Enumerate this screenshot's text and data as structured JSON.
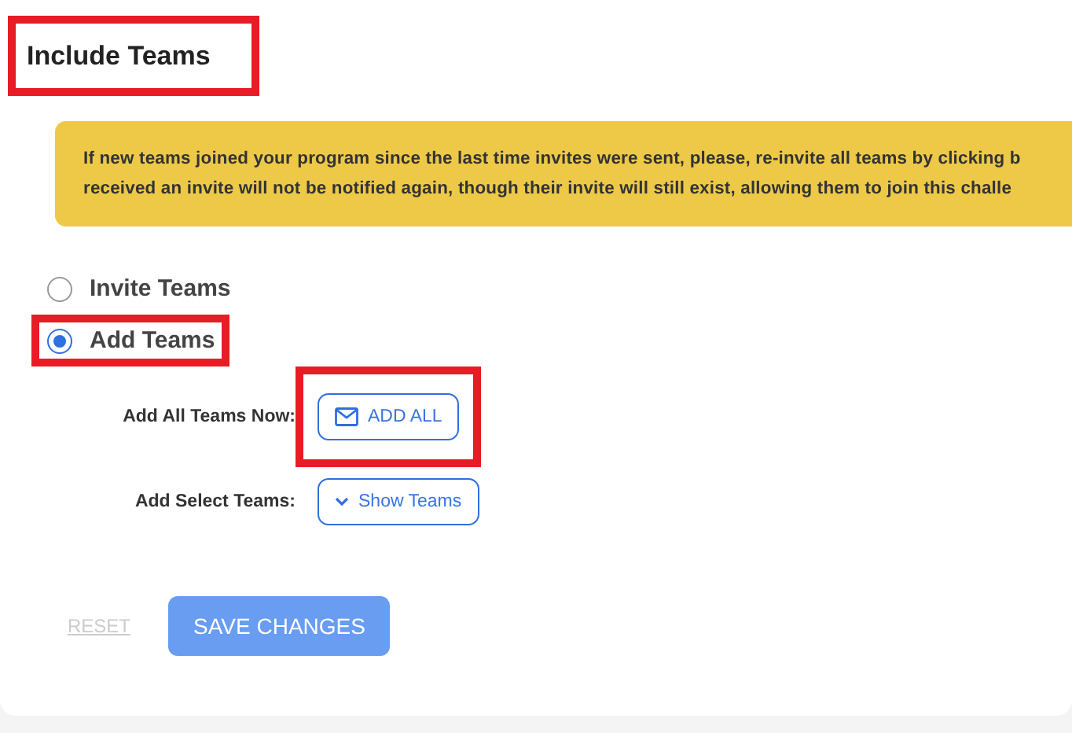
{
  "title": {
    "text": "Include Teams",
    "highlighted": true
  },
  "notice": [
    "If new teams joined your program since the last time invites were sent, please, re-invite all teams by clicking b",
    "received an invite will not be notified again, though their invite will still exist, allowing them to join this challe"
  ],
  "options": [
    {
      "label": "Invite Teams",
      "selected": false,
      "highlighted": false
    },
    {
      "label": "Add Teams",
      "selected": true,
      "highlighted": true
    }
  ],
  "actions": [
    {
      "label": "Add All Teams Now:",
      "button": "ADD ALL",
      "kind": "mail",
      "highlighted": true
    },
    {
      "label": "Add Select Teams:",
      "button": "Show Teams",
      "kind": "dropdown",
      "highlighted": false
    }
  ],
  "footer": {
    "reset": {
      "label": "RESET",
      "disabled": true
    },
    "save": {
      "label": "SAVE CHANGES",
      "disabled": true
    }
  }
}
